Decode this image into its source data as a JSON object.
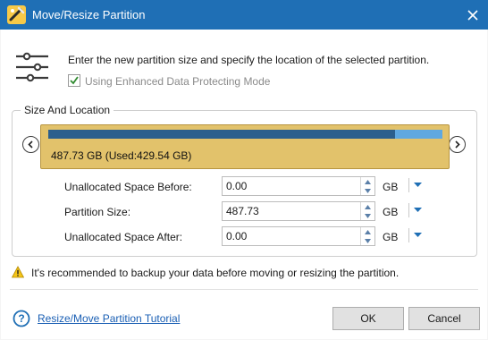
{
  "window": {
    "title": "Move/Resize Partition",
    "accent": "#1f6fb5"
  },
  "intro": {
    "description": "Enter the new partition size and specify the location of the selected partition.",
    "enhanced_mode_label": "Using Enhanced Data Protecting Mode",
    "enhanced_mode_checked": true
  },
  "group": {
    "legend": "Size And Location"
  },
  "disk": {
    "label": "487.73 GB (Used:429.54 GB)",
    "used_fraction": 0.8807,
    "used_color": "#2b5f8d",
    "free_color": "#5fa8e0",
    "partition_color": "#e2c26b"
  },
  "fields": [
    {
      "label": "Unallocated Space Before:",
      "value": "0.00",
      "unit": "GB"
    },
    {
      "label": "Partition Size:",
      "value": "487.73",
      "unit": "GB"
    },
    {
      "label": "Unallocated Space After:",
      "value": "0.00",
      "unit": "GB"
    }
  ],
  "warning": {
    "text": "It's recommended to backup your data before moving or resizing the partition."
  },
  "footer": {
    "help_link": "Resize/Move Partition Tutorial",
    "ok_label": "OK",
    "cancel_label": "Cancel"
  }
}
